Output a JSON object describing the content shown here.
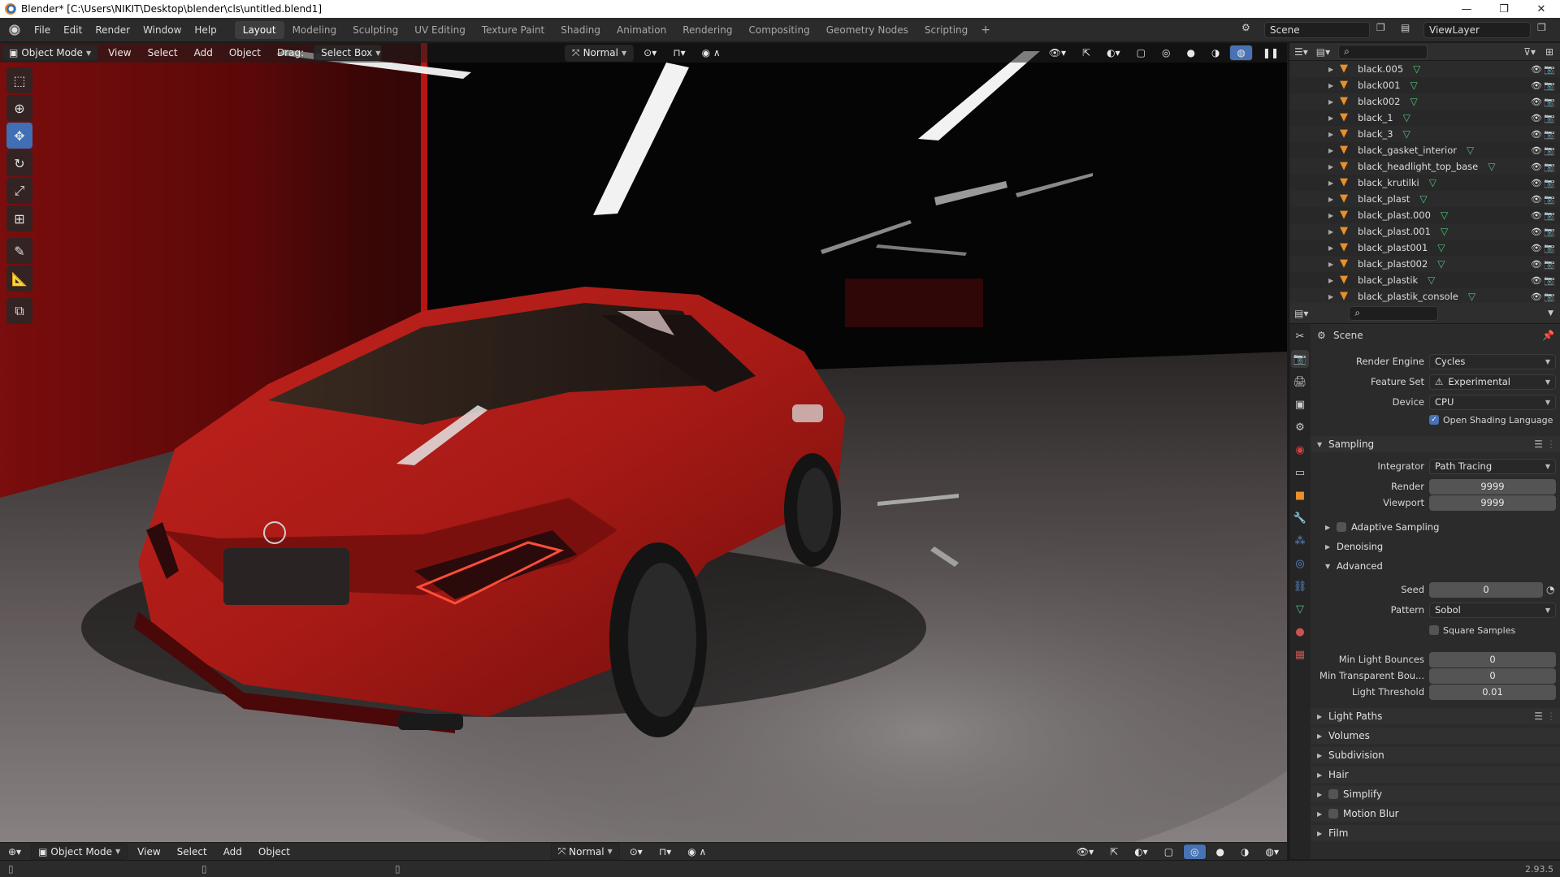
{
  "window": {
    "title": "Blender* [C:\\Users\\NIKIT\\Desktop\\blender\\cls\\untitled.blend1]",
    "minimize": "—",
    "maximize": "❐",
    "close": "✕"
  },
  "menus": [
    "File",
    "Edit",
    "Render",
    "Window",
    "Help"
  ],
  "workspaces": [
    "Layout",
    "Modeling",
    "Sculpting",
    "UV Editing",
    "Texture Paint",
    "Shading",
    "Animation",
    "Rendering",
    "Compositing",
    "Geometry Nodes",
    "Scripting"
  ],
  "scene_name": "Scene",
  "view_layer": "ViewLayer",
  "viewport_header": {
    "mode": "Object Mode",
    "view": "View",
    "select": "Select",
    "add": "Add",
    "object": "Object",
    "drag_label": "Drag:",
    "drag_value": "Select Box",
    "orientation": "Normal"
  },
  "viewport_footer": {
    "mode": "Object Mode",
    "view": "View",
    "select": "Select",
    "add": "Add",
    "object": "Object",
    "orientation": "Normal"
  },
  "outliner_items": [
    "black.005",
    "black001",
    "black002",
    "black_1",
    "black_3",
    "black_gasket_interior",
    "black_headlight_top_base",
    "black_krutilki",
    "black_plast",
    "black_plast.000",
    "black_plast.001",
    "black_plast001",
    "black_plast002",
    "black_plastik",
    "black_plastik_console"
  ],
  "properties": {
    "context": "Scene",
    "render_engine_label": "Render Engine",
    "render_engine": "Cycles",
    "feature_set_label": "Feature Set",
    "feature_set": "Experimental",
    "device_label": "Device",
    "device": "CPU",
    "osl_label": "Open Shading Language",
    "osl_checked": true,
    "sampling": {
      "title": "Sampling",
      "integrator_label": "Integrator",
      "integrator": "Path Tracing",
      "render_label": "Render",
      "render": "9999",
      "viewport_label": "Viewport",
      "viewport": "9999",
      "adaptive_label": "Adaptive Sampling",
      "denoising_label": "Denoising",
      "advanced_label": "Advanced",
      "seed_label": "Seed",
      "seed": "0",
      "pattern_label": "Pattern",
      "pattern": "Sobol",
      "square_label": "Square Samples",
      "min_bounces_label": "Min Light Bounces",
      "min_bounces": "0",
      "min_transparent_label": "Min Transparent Bou...",
      "min_transparent": "0",
      "light_threshold_label": "Light Threshold",
      "light_threshold": "0.01"
    },
    "sections": [
      "Light Paths",
      "Volumes",
      "Subdivision",
      "Hair",
      "Simplify",
      "Motion Blur",
      "Film"
    ]
  },
  "version": "2.93.5",
  "colors": {
    "accent": "#4772b3",
    "object_orange": "#e8902a",
    "mesh_green": "#52c27c",
    "car_red": "#c0231f"
  }
}
